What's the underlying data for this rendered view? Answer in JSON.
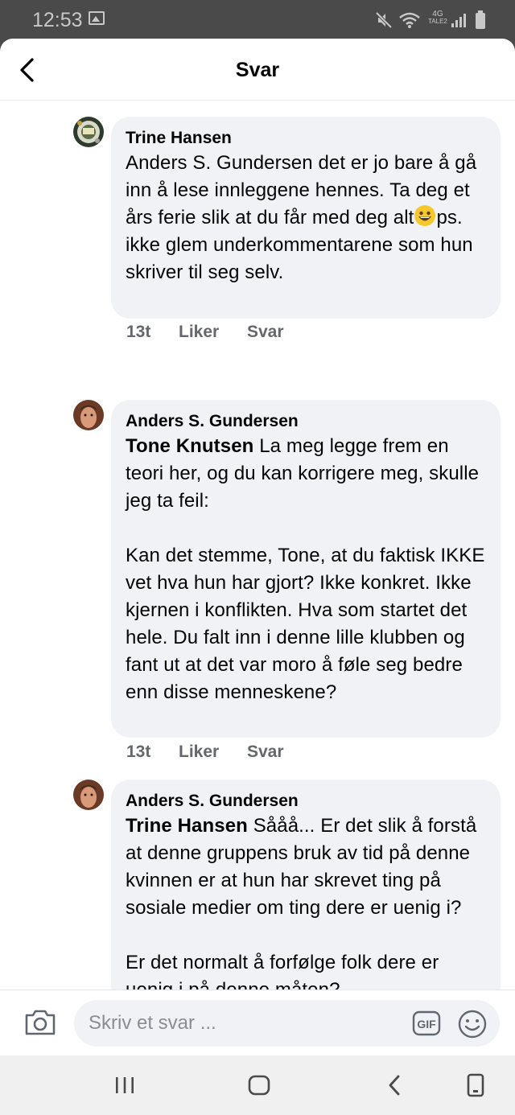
{
  "status_bar": {
    "time": "12:53",
    "network_top": "4G",
    "network_bottom": "TALE2",
    "icons": [
      "gallery-icon",
      "mute-icon",
      "wifi-icon",
      "signal-icon",
      "battery-icon"
    ]
  },
  "header": {
    "title": "Svar",
    "back_icon": "chevron-left-icon"
  },
  "comments": [
    {
      "author": "Trine Hansen",
      "avatar_icon": "avatar-trine-hansen",
      "text_before_emoji": "Anders S. Gundersen det er jo bare å gå inn å lese innleggene hennes. Ta deg et års ferie slik at du får med deg alt",
      "emoji": "grinning-face-emoji",
      "text_after_emoji": "ps. ikke glem underkommentarene som hun skriver til seg selv.",
      "time": "13t",
      "like_label": "Liker",
      "reply_label": "Svar"
    },
    {
      "author": "Anders S. Gundersen",
      "avatar_icon": "avatar-anders-gundersen",
      "mention": "Tone Knutsen",
      "text": " La meg legge frem en teori her, og du kan korrigere meg, skulle jeg ta feil:\n\nKan det stemme, Tone, at du faktisk IKKE vet hva hun har gjort? Ikke konkret. Ikke kjernen i konflikten. Hva som startet det hele. Du falt inn i denne lille klubben og fant ut at det var moro å føle seg bedre enn disse menneskene?",
      "time": "13t",
      "like_label": "Liker",
      "reply_label": "Svar"
    },
    {
      "author": "Anders S. Gundersen",
      "avatar_icon": "avatar-anders-gundersen",
      "mention": "Trine Hansen",
      "text": " Sååå... Er det slik å forstå at denne gruppens bruk av tid på denne kvinnen er at hun har skrevet ting på sosiale medier om ting dere er uenig i?\n\nEr det normalt å forfølge folk dere er uenig i på denne måten?"
    }
  ],
  "composer": {
    "placeholder": "Skriv et svar ...",
    "value": "",
    "gif_label": "GIF",
    "icons": [
      "camera-icon",
      "gif-icon",
      "smiley-icon"
    ]
  },
  "nav_bar": {
    "icons": [
      "recent-apps-icon",
      "home-icon",
      "back-icon",
      "rotate-icon"
    ]
  },
  "colors": {
    "bubble": "#f0f2f5",
    "text": "#050505",
    "meta": "#65676b",
    "status_bar": "#4a4a4a"
  }
}
